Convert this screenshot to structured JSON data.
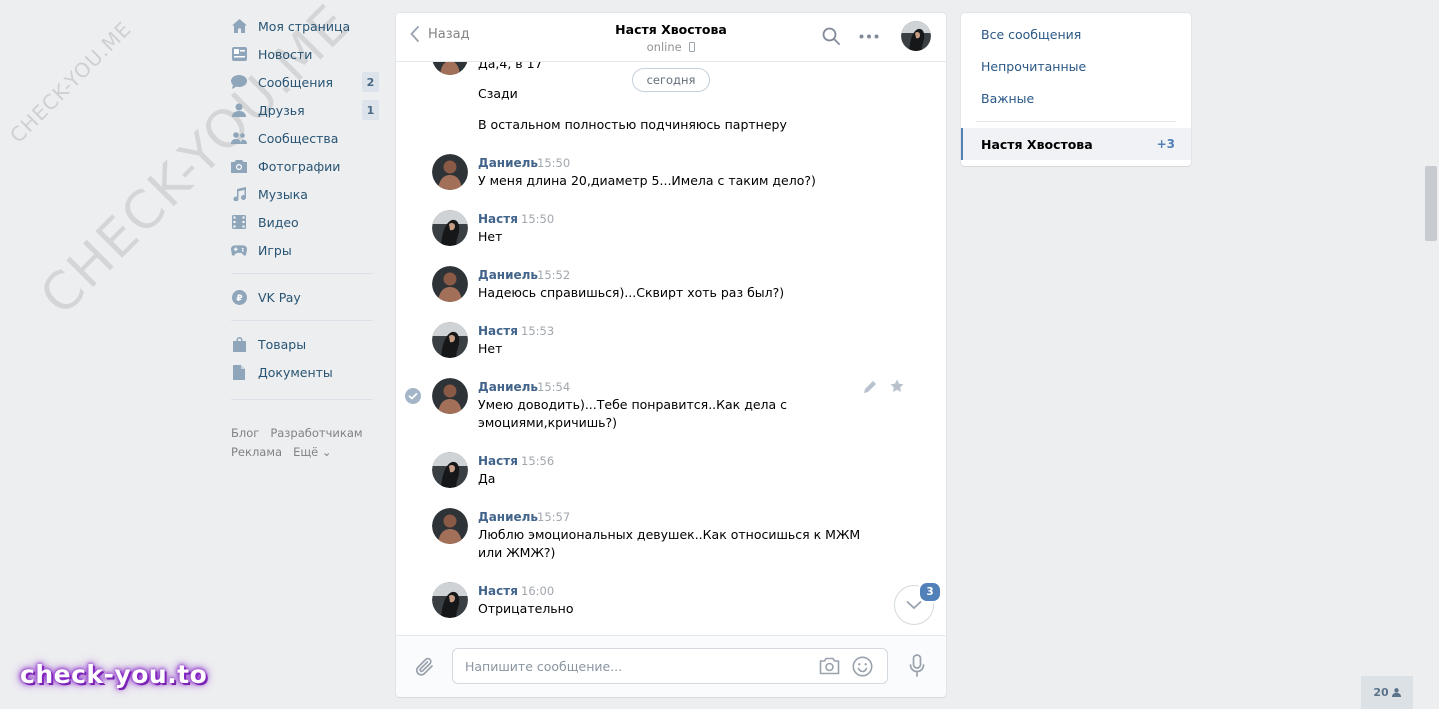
{
  "watermark": {
    "small": "CHECK-YOU.ME",
    "big": "CHECK-YOU.ME",
    "brand": "check-you.to"
  },
  "nav": {
    "items": [
      {
        "label": "Моя страница",
        "icon": "home-icon"
      },
      {
        "label": "Новости",
        "icon": "news-icon"
      },
      {
        "label": "Сообщения",
        "icon": "messages-icon",
        "badge": "2"
      },
      {
        "label": "Друзья",
        "icon": "friends-icon",
        "badge": "1"
      },
      {
        "label": "Сообщества",
        "icon": "communities-icon"
      },
      {
        "label": "Фотографии",
        "icon": "camera-icon"
      },
      {
        "label": "Музыка",
        "icon": "music-icon"
      },
      {
        "label": "Видео",
        "icon": "video-icon"
      },
      {
        "label": "Игры",
        "icon": "games-icon"
      }
    ],
    "pay": {
      "label": "VK Pay",
      "icon": "vkpay-icon"
    },
    "items2": [
      {
        "label": "Товары",
        "icon": "bag-icon"
      },
      {
        "label": "Документы",
        "icon": "document-icon"
      }
    ],
    "footer": [
      "Блог",
      "Разработчикам",
      "Реклама",
      "Ещё ⌄"
    ]
  },
  "chat": {
    "back_label": "Назад",
    "peer_name": "Настя Хвостова",
    "peer_status": "online",
    "day_label": "сегодня",
    "top_lines": [
      "Да,4, в 17",
      "Сзади",
      "В остальном полностью подчиняюсь партнеру"
    ],
    "messages": [
      {
        "author": "Даниель",
        "time": "15:50",
        "lines": [
          "У меня длина 20,диаметр 5...Имела с таким дело?)"
        ]
      },
      {
        "author": "Настя",
        "time": "15:50",
        "lines": [
          "Нет"
        ]
      },
      {
        "author": "Даниель",
        "time": "15:52",
        "lines": [
          "Надеюсь справишься)...Сквирт хоть раз был?)"
        ]
      },
      {
        "author": "Настя",
        "time": "15:53",
        "lines": [
          "Нет"
        ]
      },
      {
        "author": "Даниель",
        "time": "15:54",
        "lines": [
          "Умею доводить)...Тебе понравится..Как дела с",
          "эмоциями,кричишь?)"
        ]
      },
      {
        "author": "Настя",
        "time": "15:56",
        "lines": [
          "Да"
        ]
      },
      {
        "author": "Даниель",
        "time": "15:57",
        "lines": [
          "Люблю эмоциональных девушек..Как относишься к МЖМ",
          "или ЖМЖ?)"
        ]
      },
      {
        "author": "Настя",
        "time": "16:00",
        "lines": [
          "Отрицательно"
        ]
      }
    ],
    "compose_placeholder": "Напишите сообщение...",
    "unread_badge": "3"
  },
  "right": {
    "filters": [
      "Все сообщения",
      "Непрочитанные",
      "Важные"
    ],
    "active_name": "Настя Хвостова",
    "active_count": "+3"
  },
  "online_count": "20",
  "colors": {
    "link": "#2a5885",
    "author": "#42648b",
    "accent": "#5181b8",
    "bg": "#edeef0"
  }
}
